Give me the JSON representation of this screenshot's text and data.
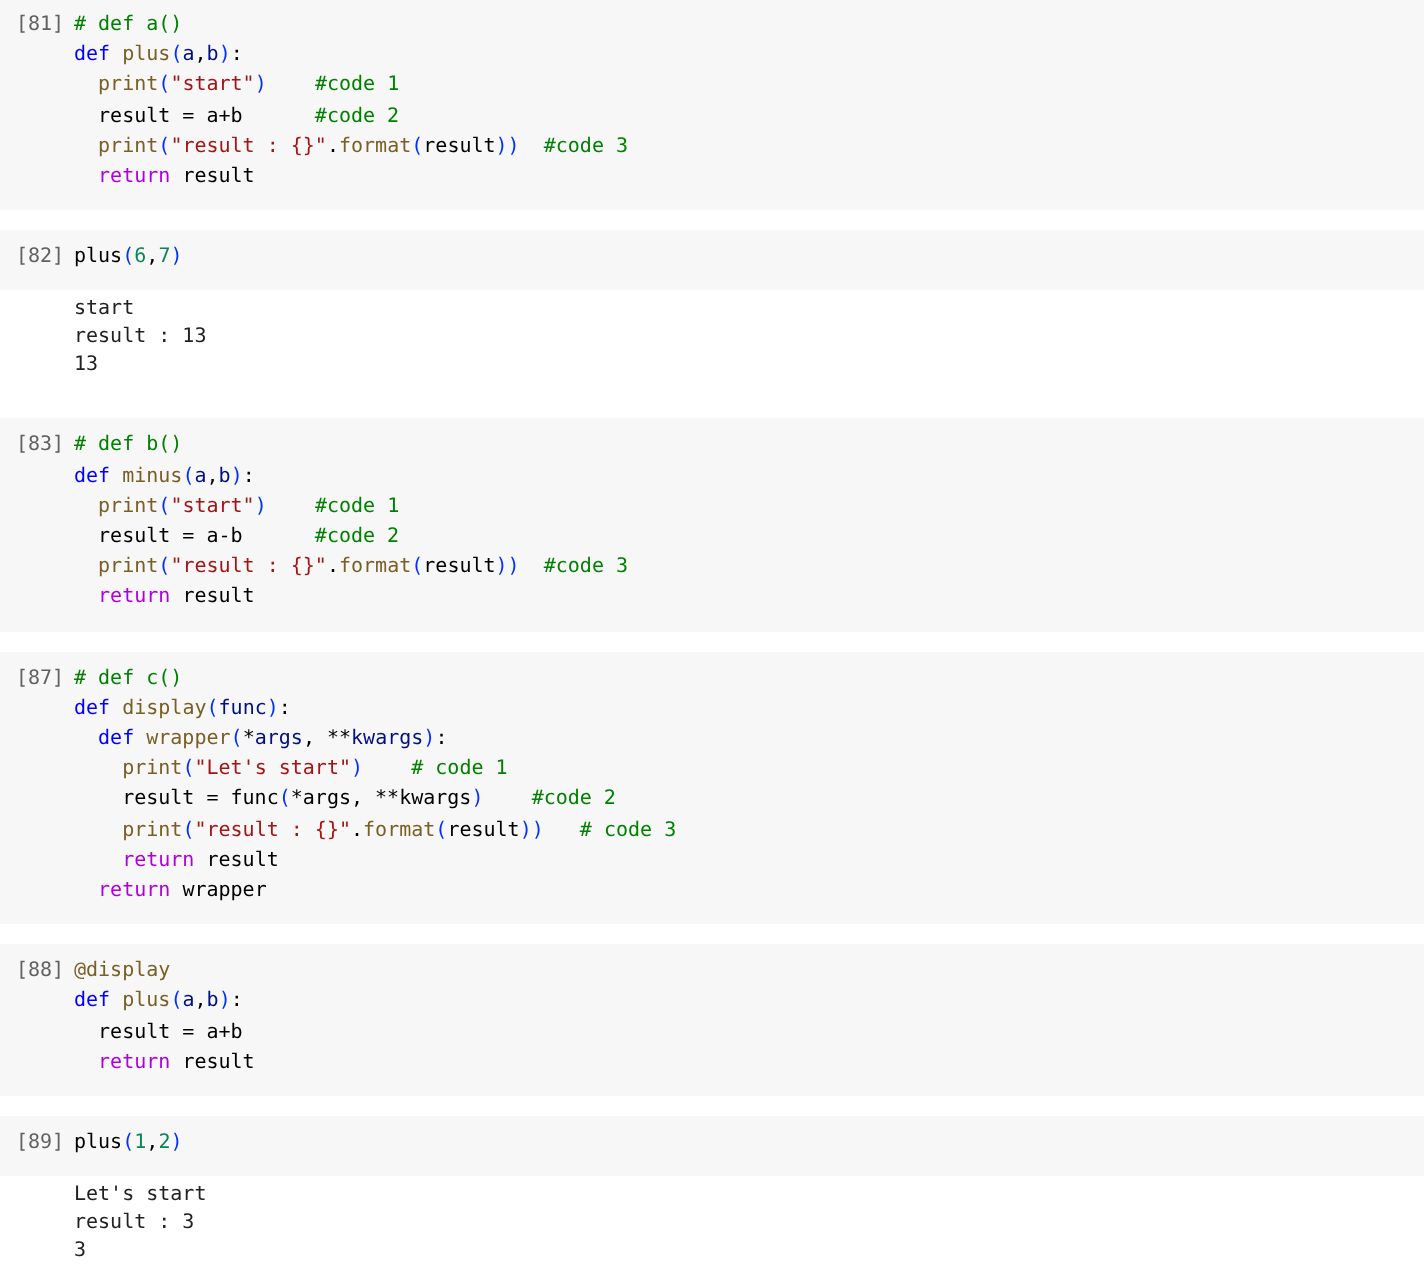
{
  "cells": [
    {
      "prompt": "[81]",
      "code": [
        [
          {
            "kind": "comment",
            "text": "# def a()"
          }
        ],
        [
          {
            "kind": "keyword",
            "text": "def "
          },
          {
            "kind": "func",
            "text": "plus"
          },
          {
            "kind": "bracket",
            "text": "("
          },
          {
            "kind": "param",
            "text": "a"
          },
          {
            "kind": "plain",
            "text": ","
          },
          {
            "kind": "param",
            "text": "b"
          },
          {
            "kind": "bracket",
            "text": ")"
          },
          {
            "kind": "plain",
            "text": ":"
          }
        ],
        [
          {
            "kind": "func",
            "text": "  print"
          },
          {
            "kind": "bracket",
            "text": "("
          },
          {
            "kind": "string",
            "text": "\"start\""
          },
          {
            "kind": "bracket",
            "text": ")    "
          },
          {
            "kind": "comment",
            "text": "#code 1"
          }
        ],
        [
          {
            "kind": "plain",
            "text": "  result = a+b      "
          },
          {
            "kind": "comment",
            "text": "#code 2"
          }
        ],
        [
          {
            "kind": "func",
            "text": "  print"
          },
          {
            "kind": "bracket",
            "text": "("
          },
          {
            "kind": "string",
            "text": "\"result : {}\""
          },
          {
            "kind": "plain",
            "text": "."
          },
          {
            "kind": "func",
            "text": "format"
          },
          {
            "kind": "bracket",
            "text": "("
          },
          {
            "kind": "plain",
            "text": "result"
          },
          {
            "kind": "bracket",
            "text": "))  "
          },
          {
            "kind": "comment",
            "text": "#code 3"
          }
        ],
        [
          {
            "kind": "control",
            "text": "  return"
          },
          {
            "kind": "plain",
            "text": " result"
          }
        ]
      ]
    },
    {
      "prompt": "[82]",
      "code": [
        [
          {
            "kind": "plain",
            "text": "plus"
          },
          {
            "kind": "bracket",
            "text": "("
          },
          {
            "kind": "number",
            "text": "6"
          },
          {
            "kind": "plain",
            "text": ","
          },
          {
            "kind": "number",
            "text": "7"
          },
          {
            "kind": "bracket",
            "text": ")"
          }
        ]
      ],
      "output": [
        "start",
        "result : 13",
        "13"
      ]
    },
    {
      "prompt": "[83]",
      "code": [
        [
          {
            "kind": "comment",
            "text": "# def b()"
          }
        ],
        [
          {
            "kind": "keyword",
            "text": "def "
          },
          {
            "kind": "func",
            "text": "minus"
          },
          {
            "kind": "bracket",
            "text": "("
          },
          {
            "kind": "param",
            "text": "a"
          },
          {
            "kind": "plain",
            "text": ","
          },
          {
            "kind": "param",
            "text": "b"
          },
          {
            "kind": "bracket",
            "text": ")"
          },
          {
            "kind": "plain",
            "text": ":"
          }
        ],
        [
          {
            "kind": "func",
            "text": "  print"
          },
          {
            "kind": "bracket",
            "text": "("
          },
          {
            "kind": "string",
            "text": "\"start\""
          },
          {
            "kind": "bracket",
            "text": ")    "
          },
          {
            "kind": "comment",
            "text": "#code 1"
          }
        ],
        [
          {
            "kind": "plain",
            "text": "  result = a-b      "
          },
          {
            "kind": "comment",
            "text": "#code 2"
          }
        ],
        [
          {
            "kind": "func",
            "text": "  print"
          },
          {
            "kind": "bracket",
            "text": "("
          },
          {
            "kind": "string",
            "text": "\"result : {}\""
          },
          {
            "kind": "plain",
            "text": "."
          },
          {
            "kind": "func",
            "text": "format"
          },
          {
            "kind": "bracket",
            "text": "("
          },
          {
            "kind": "plain",
            "text": "result"
          },
          {
            "kind": "bracket",
            "text": "))  "
          },
          {
            "kind": "comment",
            "text": "#code 3"
          }
        ],
        [
          {
            "kind": "control",
            "text": "  return"
          },
          {
            "kind": "plain",
            "text": " result"
          }
        ]
      ]
    },
    {
      "prompt": "[87]",
      "code": [
        [
          {
            "kind": "comment",
            "text": "# def c()"
          }
        ],
        [
          {
            "kind": "keyword",
            "text": "def "
          },
          {
            "kind": "func",
            "text": "display"
          },
          {
            "kind": "bracket",
            "text": "("
          },
          {
            "kind": "param",
            "text": "func"
          },
          {
            "kind": "bracket",
            "text": ")"
          },
          {
            "kind": "plain",
            "text": ":"
          }
        ],
        [
          {
            "kind": "keyword",
            "text": "  def "
          },
          {
            "kind": "func",
            "text": "wrapper"
          },
          {
            "kind": "bracket",
            "text": "("
          },
          {
            "kind": "plain",
            "text": "*"
          },
          {
            "kind": "param",
            "text": "args"
          },
          {
            "kind": "plain",
            "text": ", **"
          },
          {
            "kind": "param",
            "text": "kwargs"
          },
          {
            "kind": "bracket",
            "text": ")"
          },
          {
            "kind": "plain",
            "text": ":"
          }
        ],
        [
          {
            "kind": "func",
            "text": "    print"
          },
          {
            "kind": "bracket",
            "text": "("
          },
          {
            "kind": "string",
            "text": "\"Let's start\""
          },
          {
            "kind": "bracket",
            "text": ")    "
          },
          {
            "kind": "comment",
            "text": "# code 1"
          }
        ],
        [
          {
            "kind": "plain",
            "text": "    result = func"
          },
          {
            "kind": "bracket",
            "text": "("
          },
          {
            "kind": "plain",
            "text": "*args, **kwargs"
          },
          {
            "kind": "bracket",
            "text": ")    "
          },
          {
            "kind": "comment",
            "text": "#code 2"
          }
        ],
        [
          {
            "kind": "func",
            "text": "    print"
          },
          {
            "kind": "bracket",
            "text": "("
          },
          {
            "kind": "string",
            "text": "\"result : {}\""
          },
          {
            "kind": "plain",
            "text": "."
          },
          {
            "kind": "func",
            "text": "format"
          },
          {
            "kind": "bracket",
            "text": "("
          },
          {
            "kind": "plain",
            "text": "result"
          },
          {
            "kind": "bracket",
            "text": "))   "
          },
          {
            "kind": "comment",
            "text": "# code 3"
          }
        ],
        [
          {
            "kind": "control",
            "text": "    return"
          },
          {
            "kind": "plain",
            "text": " result"
          }
        ],
        [
          {
            "kind": "control",
            "text": "  return"
          },
          {
            "kind": "plain",
            "text": " wrapper"
          }
        ]
      ]
    },
    {
      "prompt": "[88]",
      "code": [
        [
          {
            "kind": "func",
            "text": "@display"
          }
        ],
        [
          {
            "kind": "keyword",
            "text": "def "
          },
          {
            "kind": "func",
            "text": "plus"
          },
          {
            "kind": "bracket",
            "text": "("
          },
          {
            "kind": "param",
            "text": "a"
          },
          {
            "kind": "plain",
            "text": ","
          },
          {
            "kind": "param",
            "text": "b"
          },
          {
            "kind": "bracket",
            "text": ")"
          },
          {
            "kind": "plain",
            "text": ":"
          }
        ],
        [
          {
            "kind": "plain",
            "text": "  result = a+b"
          }
        ],
        [
          {
            "kind": "control",
            "text": "  return"
          },
          {
            "kind": "plain",
            "text": " result"
          }
        ]
      ]
    },
    {
      "prompt": "[89]",
      "code": [
        [
          {
            "kind": "plain",
            "text": "plus"
          },
          {
            "kind": "bracket",
            "text": "("
          },
          {
            "kind": "number",
            "text": "1"
          },
          {
            "kind": "plain",
            "text": ","
          },
          {
            "kind": "number",
            "text": "2"
          },
          {
            "kind": "bracket",
            "text": ")"
          }
        ]
      ],
      "output": [
        "Let's start",
        "result : 3",
        "3"
      ]
    }
  ]
}
